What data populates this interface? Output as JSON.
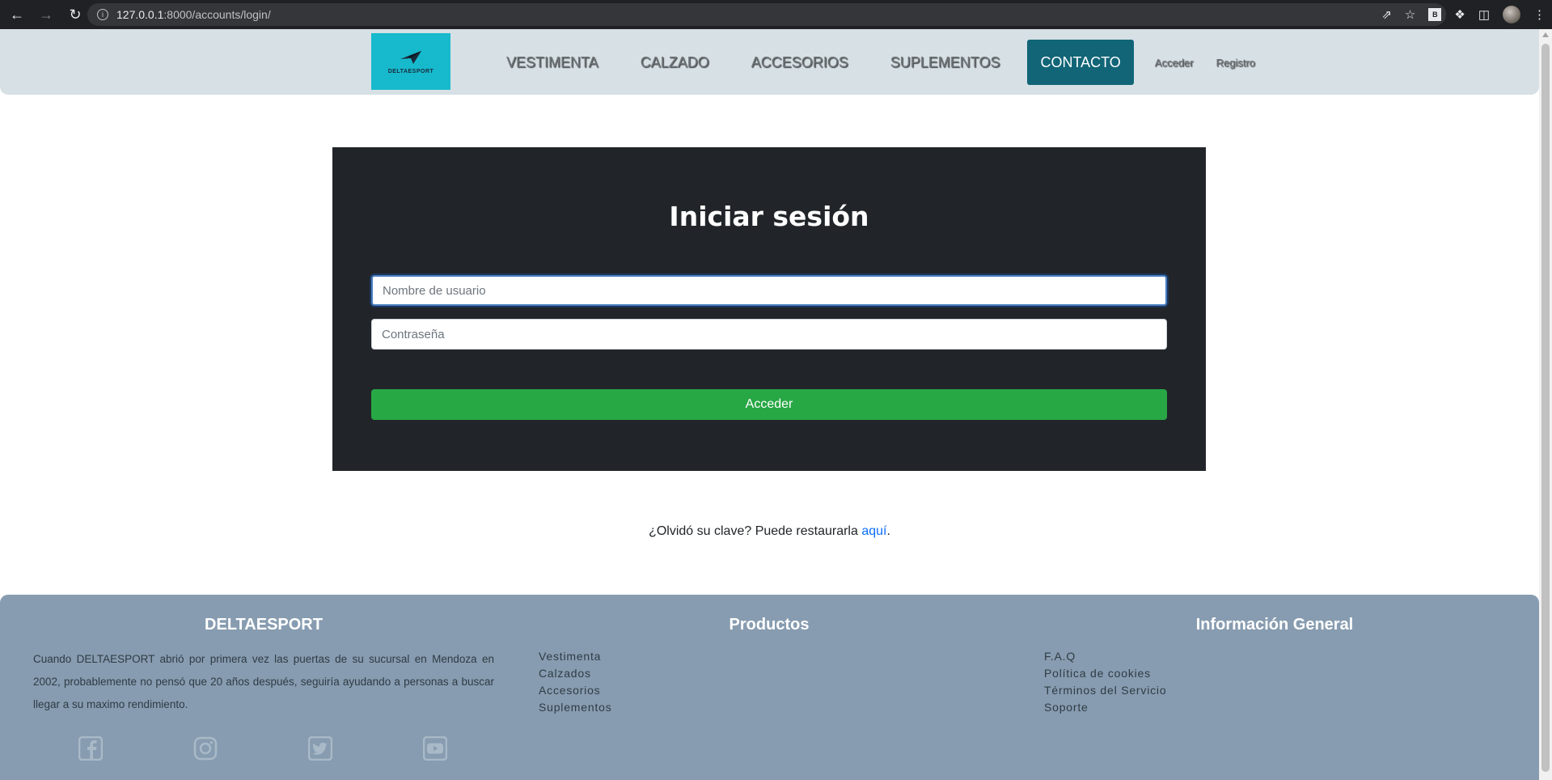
{
  "browser": {
    "url_host": "127.0.0.1",
    "url_path": ":8000/accounts/login/",
    "extension_label": "B"
  },
  "navbar": {
    "logo_text": "DELTAESPORT",
    "links": [
      "VESTIMENTA",
      "CALZADO",
      "ACCESORIOS",
      "SUPLEMENTOS"
    ],
    "active_link": "CONTACTO",
    "login_link": "Acceder",
    "register_link": "Registro"
  },
  "login": {
    "title": "Iniciar sesión",
    "username_placeholder": "Nombre de usuario",
    "password_placeholder": "Contraseña",
    "submit_label": "Acceder"
  },
  "forgot": {
    "text": "¿Olvidó su clave? Puede restaurarla ",
    "link": "aquí",
    "suffix": "."
  },
  "footer": {
    "brand_title": "DELTAESPORT",
    "brand_description": "Cuando DELTAESPORT abrió por primera vez las puertas de su sucursal en Mendoza en 2002, probablemente no pensó que 20 años después, seguiría ayudando a personas a buscar llegar a su maximo rendimiento.",
    "products_title": "Productos",
    "products": [
      "Vestimenta",
      "Calzados",
      "Accesorios",
      "Suplementos"
    ],
    "info_title": "Información General",
    "info_links": [
      "F.A.Q",
      "Política de cookies",
      "Términos del Servicio",
      "Soporte"
    ],
    "social_icons": [
      "facebook-icon",
      "instagram-icon",
      "twitter-icon",
      "youtube-icon"
    ]
  },
  "colors": {
    "navbar_bg": "#d6e0e5",
    "active_nav_bg": "#116577",
    "logo_bg": "#17b9cc",
    "card_bg": "#212529",
    "submit_bg": "#28a745",
    "footer_bg": "#879cb0",
    "link": "#0d6efd"
  }
}
